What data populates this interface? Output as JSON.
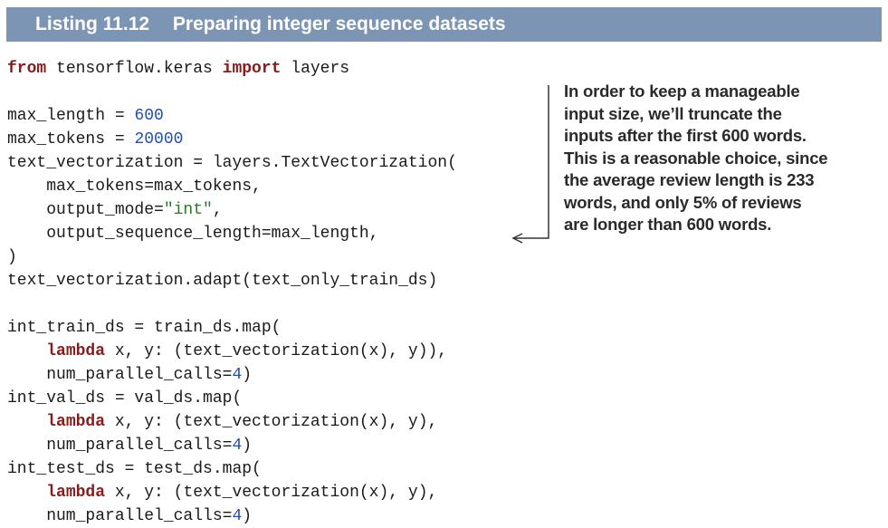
{
  "listing": {
    "number": "Listing 11.12",
    "title": "Preparing integer sequence datasets"
  },
  "code_lines": [
    [
      {
        "t": "from",
        "c": "kw"
      },
      {
        "t": " tensorflow.keras ",
        "c": ""
      },
      {
        "t": "import",
        "c": "kw"
      },
      {
        "t": " layers",
        "c": ""
      }
    ],
    [],
    [
      {
        "t": "max_length = ",
        "c": ""
      },
      {
        "t": "600",
        "c": "num-lit"
      }
    ],
    [
      {
        "t": "max_tokens = ",
        "c": ""
      },
      {
        "t": "20000",
        "c": "num-lit"
      }
    ],
    [
      {
        "t": "text_vectorization = layers.TextVectorization(",
        "c": ""
      }
    ],
    [
      {
        "t": "    max_tokens=max_tokens,",
        "c": ""
      }
    ],
    [
      {
        "t": "    output_mode=",
        "c": ""
      },
      {
        "t": "\"int\"",
        "c": "str"
      },
      {
        "t": ",",
        "c": ""
      }
    ],
    [
      {
        "t": "    output_sequence_length=max_length,",
        "c": ""
      }
    ],
    [
      {
        "t": ")",
        "c": ""
      }
    ],
    [
      {
        "t": "text_vectorization.adapt(text_only_train_ds)",
        "c": ""
      }
    ],
    [],
    [
      {
        "t": "int_train_ds = train_ds.map(",
        "c": ""
      }
    ],
    [
      {
        "t": "    ",
        "c": ""
      },
      {
        "t": "lambda",
        "c": "kw"
      },
      {
        "t": " x, y: (text_vectorization(x), y)),",
        "c": ""
      }
    ],
    [
      {
        "t": "    num_parallel_calls=",
        "c": ""
      },
      {
        "t": "4",
        "c": "num-lit"
      },
      {
        "t": ")",
        "c": ""
      }
    ],
    [
      {
        "t": "int_val_ds = val_ds.map(",
        "c": ""
      }
    ],
    [
      {
        "t": "    ",
        "c": ""
      },
      {
        "t": "lambda",
        "c": "kw"
      },
      {
        "t": " x, y: (text_vectorization(x), y),",
        "c": ""
      }
    ],
    [
      {
        "t": "    num_parallel_calls=",
        "c": ""
      },
      {
        "t": "4",
        "c": "num-lit"
      },
      {
        "t": ")",
        "c": ""
      }
    ],
    [
      {
        "t": "int_test_ds = test_ds.map(",
        "c": ""
      }
    ],
    [
      {
        "t": "    ",
        "c": ""
      },
      {
        "t": "lambda",
        "c": "kw"
      },
      {
        "t": " x, y: (text_vectorization(x), y),",
        "c": ""
      }
    ],
    [
      {
        "t": "    num_parallel_calls=",
        "c": ""
      },
      {
        "t": "4",
        "c": "num-lit"
      },
      {
        "t": ")",
        "c": ""
      }
    ]
  ],
  "annotation": {
    "lines": [
      "In order to keep a manageable",
      "input size, we’ll truncate the",
      "inputs after the first 600 words.",
      "This is a reasonable choice, since",
      "the average review length is 233",
      "words, and only 5% of reviews",
      "are longer than 600 words."
    ]
  },
  "colors": {
    "header_bg": "#7c95b5",
    "keyword": "#8b1a1a",
    "number": "#1f4fb5",
    "string": "#2a7a2a"
  }
}
